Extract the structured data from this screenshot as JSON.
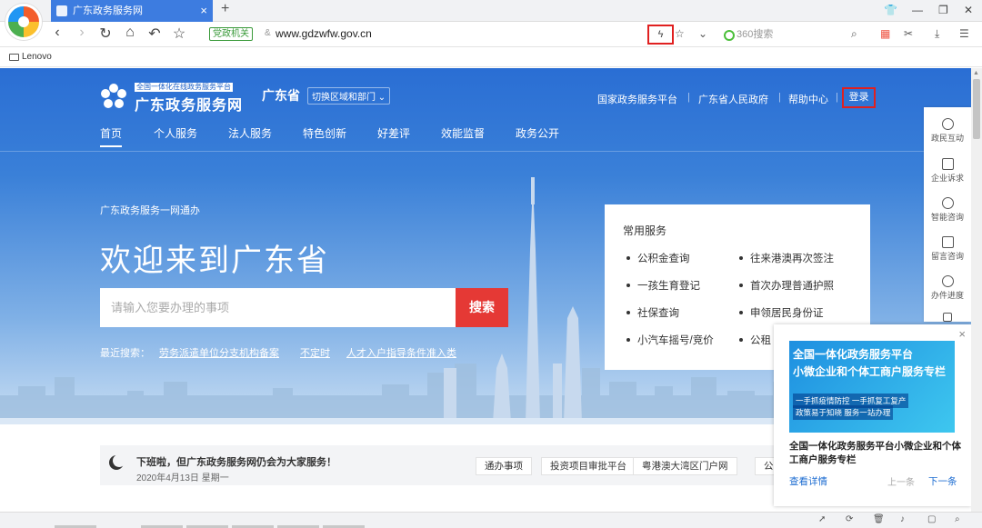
{
  "browser": {
    "tab_title": "广东政务服务网",
    "tab_close": "×",
    "new_tab": "+",
    "safe_badge": "党政机关",
    "url": "www.gdzwfw.gov.cn",
    "search_placeholder": "360搜索",
    "bookmark": "Lenovo"
  },
  "header": {
    "logo_tag": "全国一体化在线政务服务平台",
    "logo_name": "广东政务服务网",
    "province": "广东省",
    "switch_region": "切换区域和部门 ⌄",
    "links": [
      "国家政务服务平台",
      "广东省人民政府",
      "帮助中心"
    ],
    "login": "登录"
  },
  "nav": [
    "首页",
    "个人服务",
    "法人服务",
    "特色创新",
    "好差评",
    "效能监督",
    "政务公开"
  ],
  "hero": {
    "subhead": "广东政务服务一网通办",
    "welcome": "欢迎来到广东省",
    "search_placeholder": "请输入您要办理的事项",
    "search_button": "搜索",
    "recent_label": "最近搜索：",
    "recent": [
      "劳务派遣单位分支机构备案",
      "不定时",
      "人才入户指导条件准入类"
    ]
  },
  "services": {
    "title": "常用服务",
    "left": [
      "公积金查询",
      "一孩生育登记",
      "社保查询",
      "小汽车摇号/竞价"
    ],
    "right": [
      "往来港澳再次签注",
      "首次办理普通护照",
      "申领居民身份证",
      "公租"
    ]
  },
  "notice": {
    "message": "下班啦，但广东政务服务网仍会为大家服务！",
    "date": "2020年4月13日 星期一",
    "quick_links": [
      "通办事项",
      "投资项目审批平台",
      "粤港澳大湾区门户网",
      "公"
    ]
  },
  "sidebar": [
    "政民互动",
    "企业诉求",
    "智能咨询",
    "留言咨询",
    "办件进度"
  ],
  "popup": {
    "close": "×",
    "banner_line1": "全国一体化政务服务平台",
    "banner_line2": "小微企业和个体工商户服务专栏",
    "banner_tag1": "一手抓疫情防控 一手抓复工复产",
    "banner_tag2": "政策易于知晓 服务一站办理",
    "title": "全国一体化政务服务平台小微企业和个体工商户服务专栏",
    "detail": "查看详情",
    "prev": "上一条",
    "next": "下一条"
  },
  "colors": {
    "brand_blue": "#2a6ed4",
    "search_red": "#e53935",
    "highlight_red": "#e02020",
    "link_blue": "#1c6cd1"
  }
}
